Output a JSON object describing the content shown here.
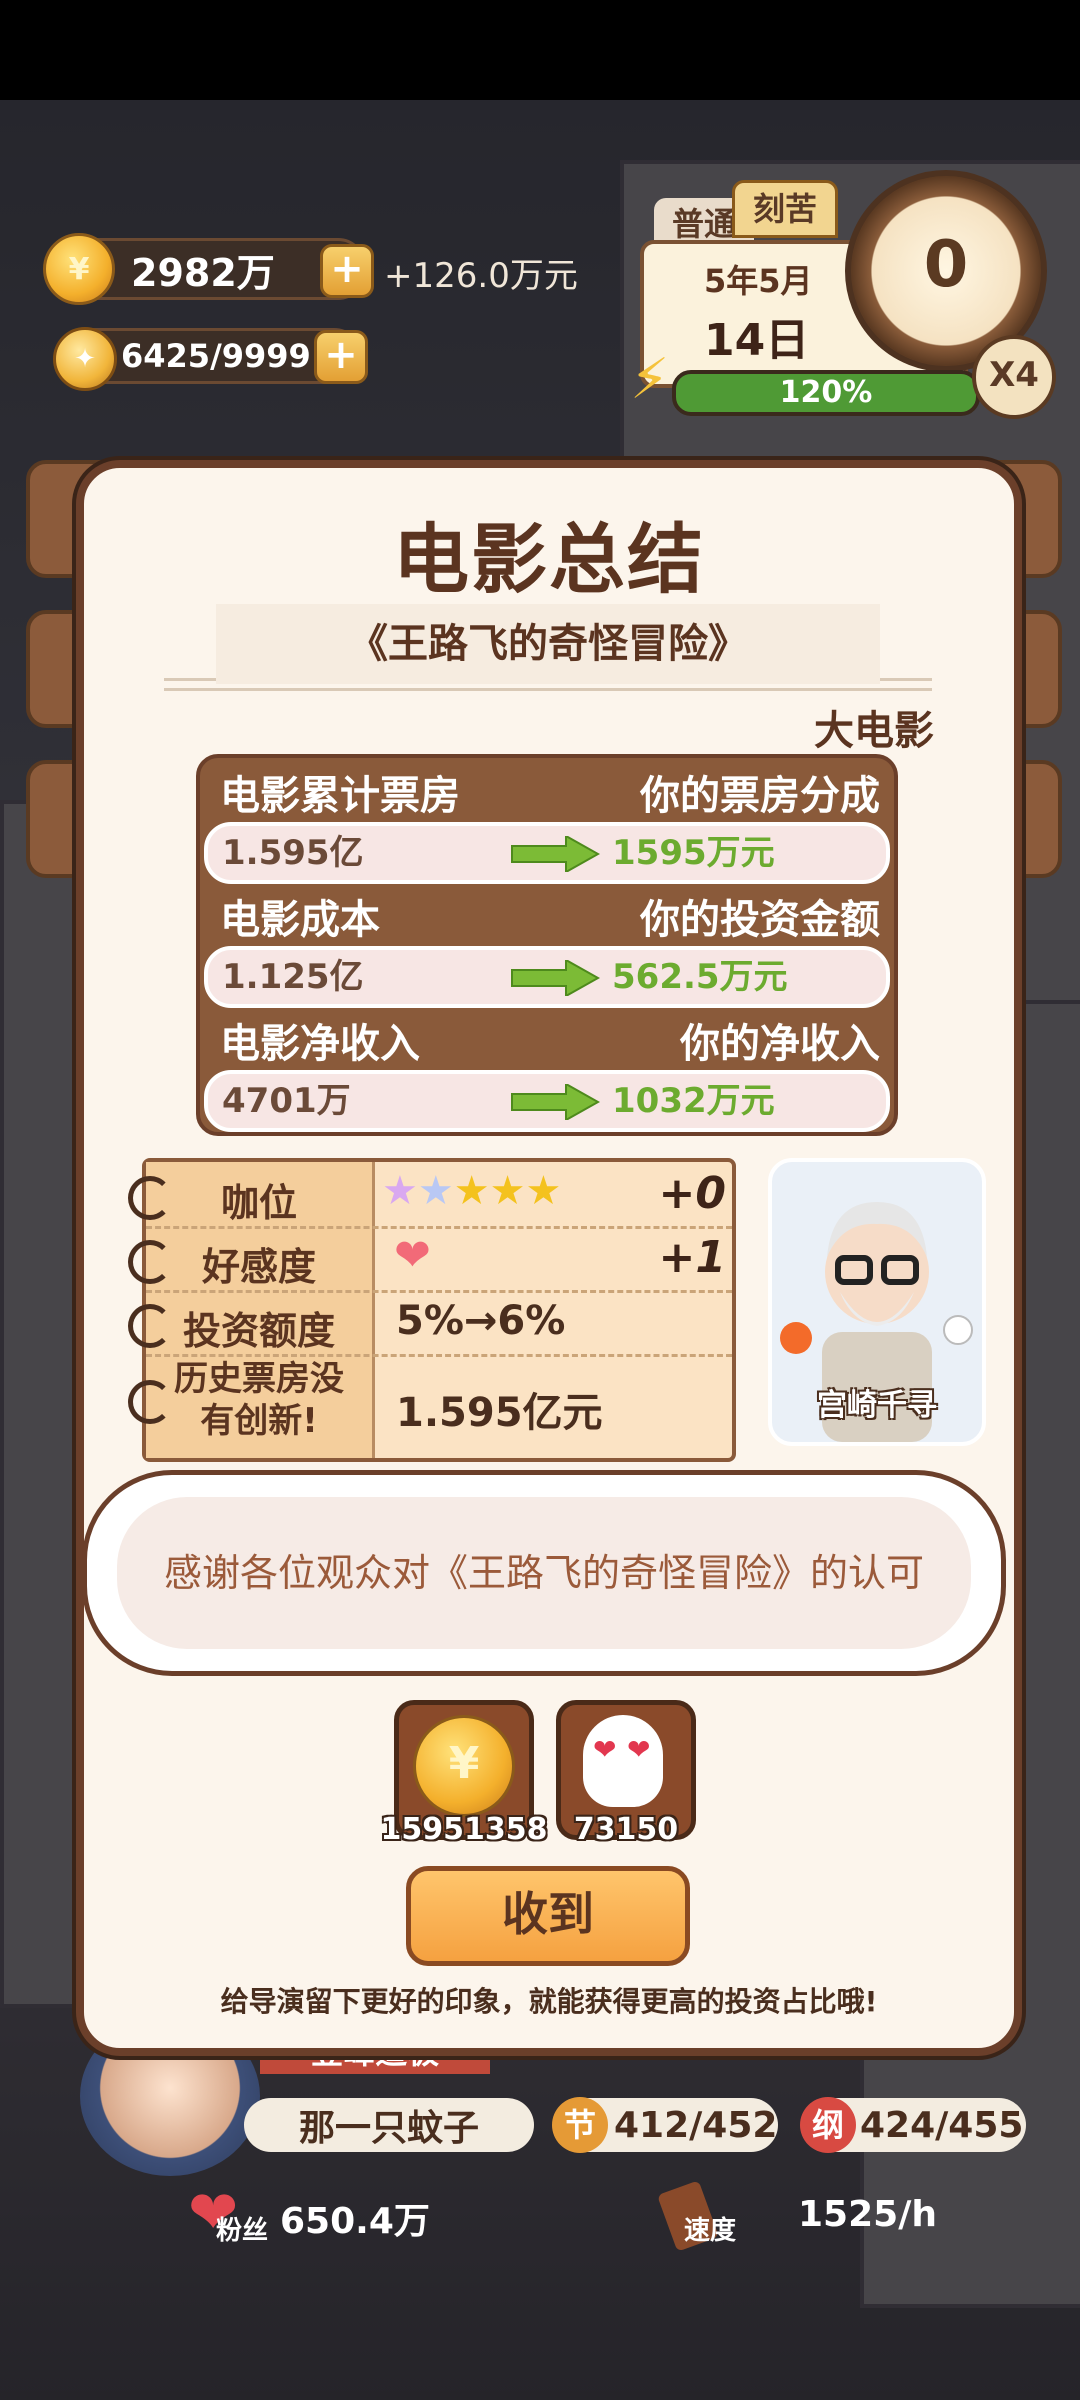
{
  "hud": {
    "money": "2982万",
    "money_rate": "+126.0万元",
    "ideas": "6425/9999",
    "mode_tabs": [
      "普通",
      "刻苦"
    ],
    "date_ym": "5年5月",
    "date_day": "14日",
    "energy_pct": "120%",
    "clock_value": "0",
    "speed_multiplier": "X4"
  },
  "modal": {
    "title": "电影总结",
    "movie_name": "《王路飞的奇怪冒险》",
    "category": "大电影",
    "stats": [
      {
        "left_label": "电影累计票房",
        "right_label": "你的票房分成",
        "left_value": "1.595亿",
        "right_value": "1595万元"
      },
      {
        "left_label": "电影成本",
        "right_label": "你的投资金额",
        "left_value": "1.125亿",
        "right_value": "562.5万元"
      },
      {
        "left_label": "电影净收入",
        "right_label": "你的净收入",
        "left_value": "4701万",
        "right_value": "1032万元"
      }
    ],
    "notebook": [
      {
        "label": "咖位",
        "value": "+0",
        "stars": 5
      },
      {
        "label": "好感度",
        "value": "+1"
      },
      {
        "label": "投资额度",
        "value": "5%→6%"
      },
      {
        "label": "历史票房没\n有创新!",
        "label_l1": "历史票房没",
        "label_l2": "有创新!",
        "value": "1.595亿元"
      }
    ],
    "director_name": "宫崎千寻",
    "speech": "感谢各位观众对《王路飞的奇怪冒险》的认可",
    "rewards": [
      {
        "icon": "coin-icon",
        "amount": "15951358"
      },
      {
        "icon": "fan-icon",
        "amount": "73150"
      }
    ],
    "confirm_label": "收到",
    "hint": "给导演留下更好的印象，就能获得更高的投资占比哦!"
  },
  "bottom": {
    "rank_partial": "登峰造极",
    "player_name": "那一只蚊子",
    "stat_jie_icon": "节",
    "stat_jie": "412/452",
    "stat_gang_icon": "纲",
    "stat_gang": "424/455",
    "fans_label": "粉丝",
    "fans": "650.4万",
    "speed_label": "速度",
    "speed": "1525/h"
  },
  "colors": {
    "modal_bg": "#fcf5ec",
    "border_brown": "#6b3f2a",
    "green_value": "#6cab2f",
    "confirm_orange": "#f5a140"
  }
}
